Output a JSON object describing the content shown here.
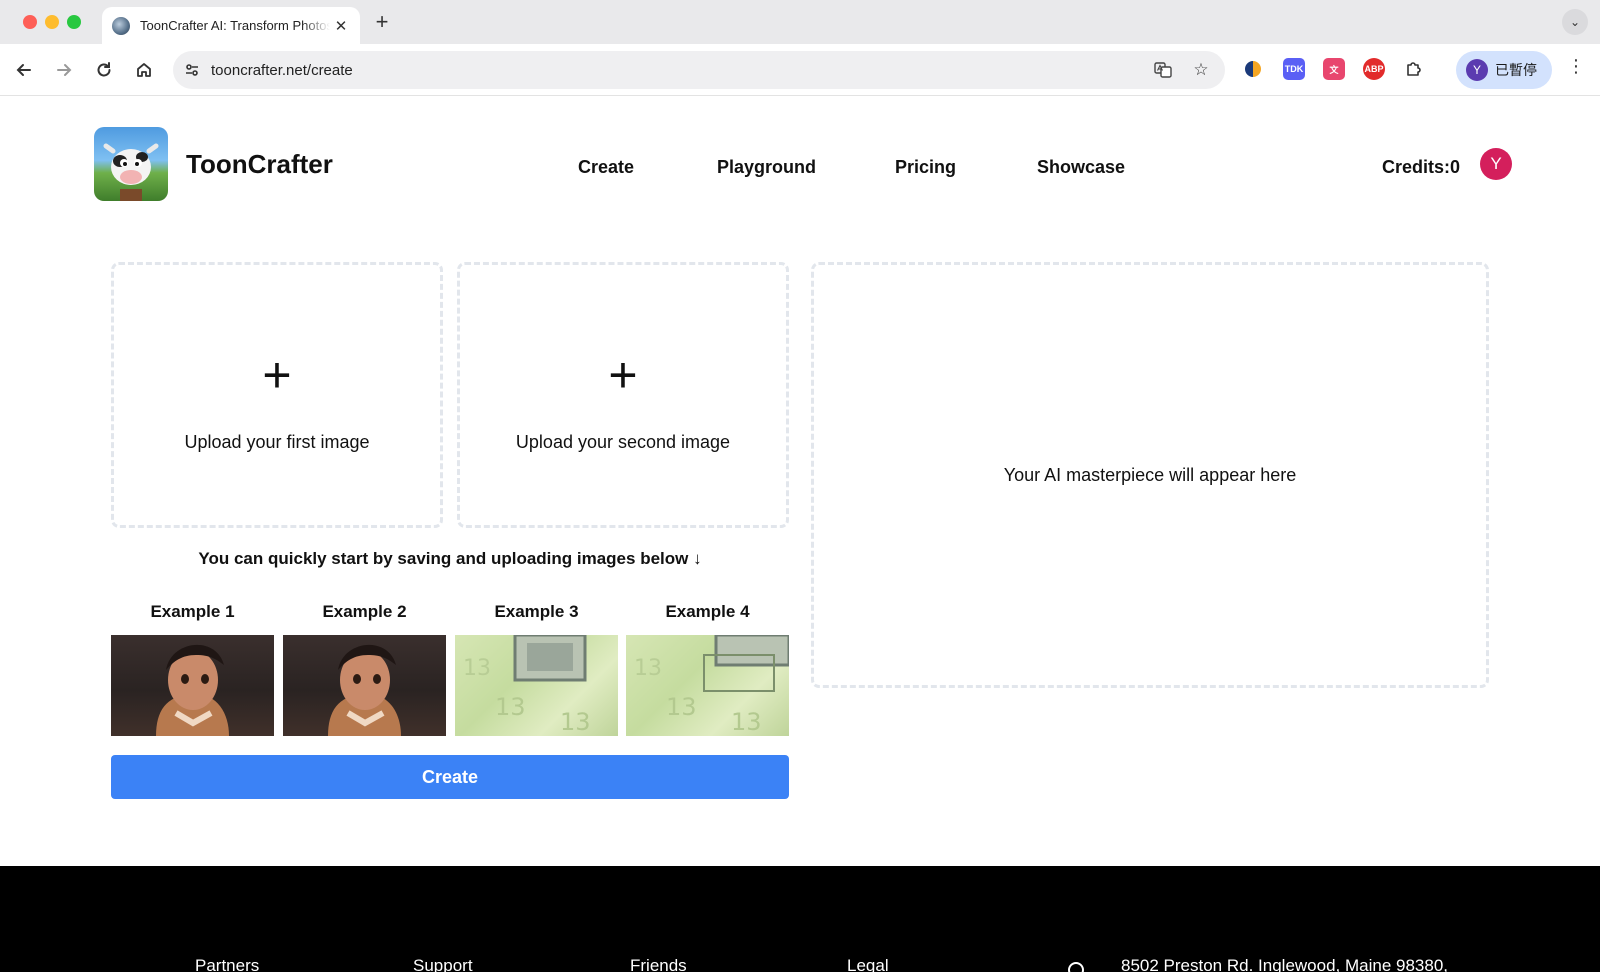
{
  "browser": {
    "tab_title": "ToonCrafter AI: Transform Photos",
    "tab_close": "✕",
    "new_tab": "+",
    "url": "tooncrafter.net/create",
    "profile_initial": "Y",
    "profile_label": "已暫停"
  },
  "header": {
    "brand": "ToonCrafter",
    "nav": [
      {
        "label": "Create"
      },
      {
        "label": "Playground"
      },
      {
        "label": "Pricing"
      },
      {
        "label": "Showcase"
      }
    ],
    "credits": "Credits:0",
    "user_initial": "Y"
  },
  "main": {
    "upload_first": {
      "icon": "+",
      "label": "Upload your first image"
    },
    "upload_second": {
      "icon": "+",
      "label": "Upload your second image"
    },
    "result_placeholder": "Your AI masterpiece will appear here",
    "hint": "You can quickly start by saving and uploading images below ↓",
    "examples": [
      {
        "label": "Example 1"
      },
      {
        "label": "Example 2"
      },
      {
        "label": "Example 3"
      },
      {
        "label": "Example 4"
      }
    ],
    "create_button": "Create"
  },
  "footer": {
    "columns": [
      {
        "label": "Partners"
      },
      {
        "label": "Support"
      },
      {
        "label": "Friends"
      },
      {
        "label": "Legal"
      }
    ],
    "address": "8502 Preston Rd. Inglewood, Maine 98380,"
  },
  "colors": {
    "accent": "#3b82f6",
    "avatar": "#d41f5c",
    "footer_bg": "#000000"
  }
}
